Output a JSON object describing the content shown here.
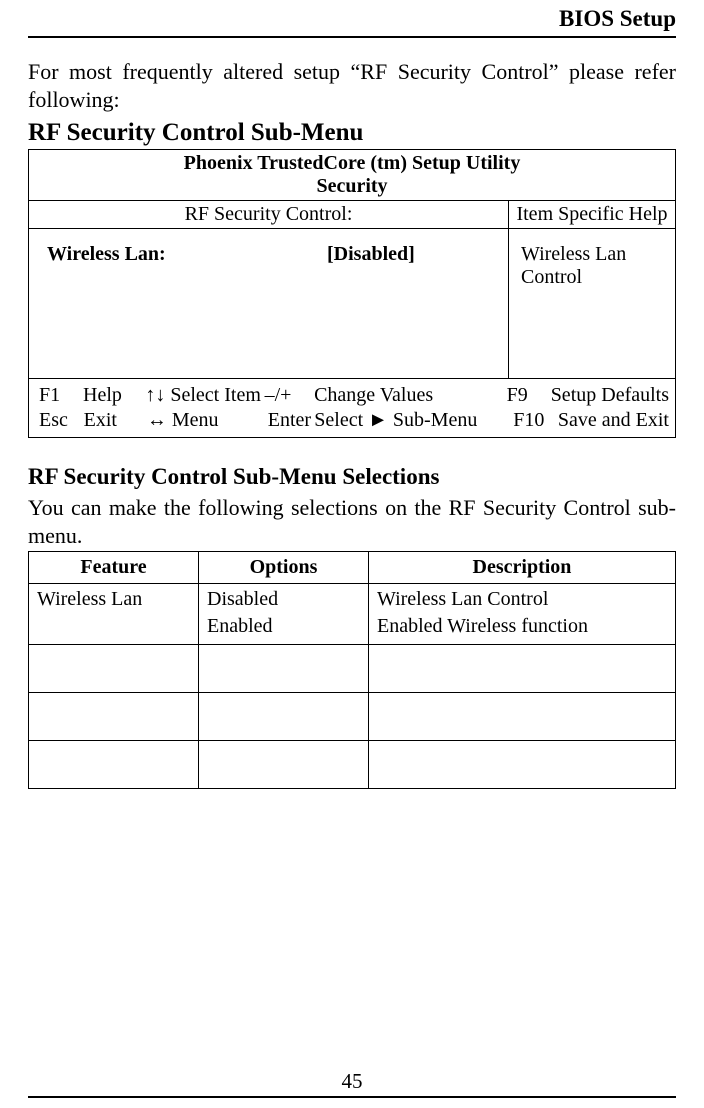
{
  "header": {
    "title": "BIOS Setup"
  },
  "intro": "For most frequently altered setup “RF Security Control” please refer following:",
  "section1_heading": "RF Security Control Sub-Menu",
  "bios": {
    "utility_title": "Phoenix TrustedCore (tm) Setup Utility",
    "tab": "Security",
    "left_heading": "RF Security Control:",
    "right_heading": "Item Specific Help",
    "item_label": "Wireless Lan:",
    "item_value": "[Disabled]",
    "help_text": "Wireless Lan Control",
    "footer": {
      "row1": {
        "k1": "F1",
        "k2": "Help",
        "k3": "↑↓ Select Item",
        "k4": "–/+",
        "k5": "Change Values",
        "k6": "F9",
        "k7": "Setup Defaults"
      },
      "row2": {
        "k1": "Esc",
        "k2": "Exit",
        "k3": "↔ Menu",
        "k4": "Enter",
        "k5": "Select ► Sub-Menu",
        "k6": "F10",
        "k7": "Save and Exit"
      }
    }
  },
  "section2_heading": "RF Security Control Sub-Menu Selections",
  "section2_para": "You can make the following selections on the RF Security Control sub-menu.",
  "selections_table": {
    "headers": {
      "feature": "Feature",
      "options": "Options",
      "description": "Description"
    },
    "row1": {
      "feature": "Wireless Lan",
      "option1": "Disabled",
      "option2": "Enabled",
      "desc1": "Wireless Lan Control",
      "desc2": "Enabled Wireless function"
    }
  },
  "page_number": "45"
}
